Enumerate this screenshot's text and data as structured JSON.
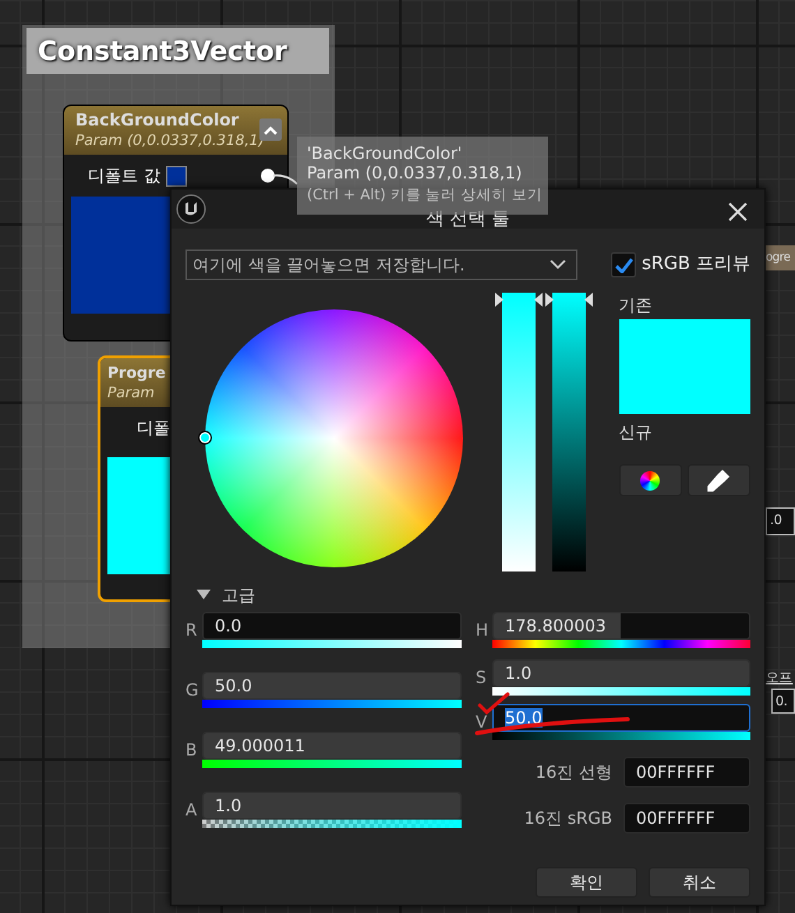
{
  "canvas": {
    "comment": {
      "title": "Constant3Vector"
    },
    "nodes": [
      {
        "title": "BackGroundColor",
        "subtitle": "Param (0,0.0337,0.318,1)",
        "row_label": "디폴트 값",
        "color": "#00309a",
        "selected": false
      },
      {
        "title": "Progre",
        "subtitle": "Param",
        "row_label": "디폴",
        "color": "#00ffff",
        "selected": true
      }
    ],
    "tooltip": {
      "lines": [
        "'BackGroundColor'",
        "Param (0,0.0337,0.318,1)"
      ],
      "hint": "(Ctrl + Alt) 키를 눌러 상세히 보기"
    },
    "fragments": [
      {
        "text": "ogre",
        "kind": "header"
      },
      {
        "text": ".0",
        "kind": "box"
      },
      {
        "text": "오프",
        "kind": "link"
      },
      {
        "text": "0.",
        "kind": "box"
      }
    ]
  },
  "dialog": {
    "title": "색 선택 툴",
    "theme_field": {
      "placeholder": "여기에 색을 끌어놓으면 저장합니다."
    },
    "srgb_preview": {
      "label": "sRGB 프리뷰",
      "checked": true
    },
    "old_label": "기존",
    "new_label": "신규",
    "value_bars": [
      {
        "level": 1
      },
      {
        "level": 1
      }
    ],
    "advanced": {
      "label": "고급",
      "expanded": true
    },
    "rgba": [
      {
        "label": "R",
        "kind": "r",
        "value": "0.0",
        "focused": false
      },
      {
        "label": "G",
        "kind": "g",
        "value": "50.0",
        "level": 1,
        "focused": false
      },
      {
        "label": "B",
        "kind": "b",
        "value": "49.000011",
        "level": 1,
        "focused": false
      },
      {
        "label": "A",
        "kind": "a",
        "value": "1.0",
        "level": 1,
        "focused": false
      }
    ],
    "hsv": [
      {
        "label": "H",
        "kind": "h",
        "value": "178.800003",
        "level": 0.497,
        "focused": false
      },
      {
        "label": "S",
        "kind": "s",
        "value": "1.0",
        "level": 1,
        "focused": false
      },
      {
        "label": "V",
        "kind": "v",
        "value": "50.0",
        "focused": true
      }
    ],
    "hex": [
      {
        "label": "16진 선형",
        "value": "00FFFFFF"
      },
      {
        "label": "16진 sRGB",
        "value": "00FFFFFF"
      }
    ],
    "buttons": [
      {
        "label": "확인"
      },
      {
        "label": "취소"
      }
    ]
  }
}
